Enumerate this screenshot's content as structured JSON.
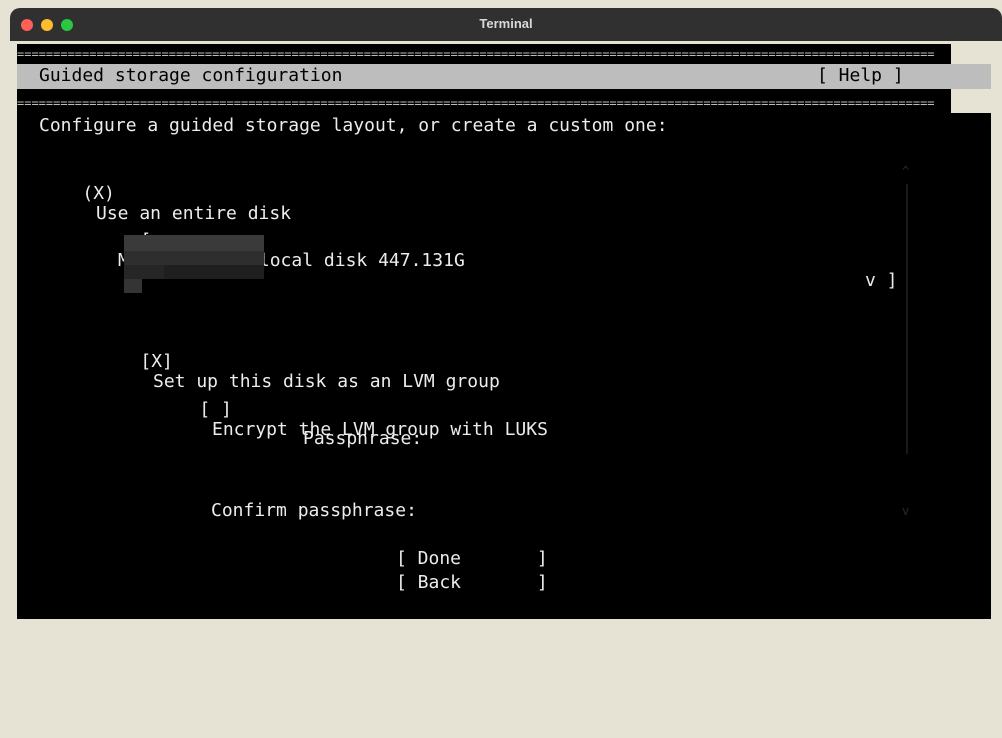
{
  "window": {
    "title": "Terminal"
  },
  "header": {
    "title": "Guided storage configuration",
    "help": "[ Help ]"
  },
  "rule": "================================================================================================================================================",
  "intro": "Configure a guided storage layout, or create a custom one:",
  "use_entire_disk": {
    "marker": "(X)",
    "label": "Use an entire disk"
  },
  "disk_select": {
    "open": "[",
    "value": "Micron_7400_ local disk 447.131G",
    "arrow": "v ]"
  },
  "lvm": {
    "marker": "[X]",
    "label": "Set up this disk as an LVM group"
  },
  "luks": {
    "marker": "[ ]",
    "label": "Encrypt the LVM group with LUKS"
  },
  "passphrase_label": "Passphrase:",
  "confirm_label": "Confirm passphrase:",
  "buttons": {
    "done": "[ Done       ]",
    "back": "[ Back       ]"
  },
  "scroll": {
    "up": "^",
    "down": "v"
  }
}
